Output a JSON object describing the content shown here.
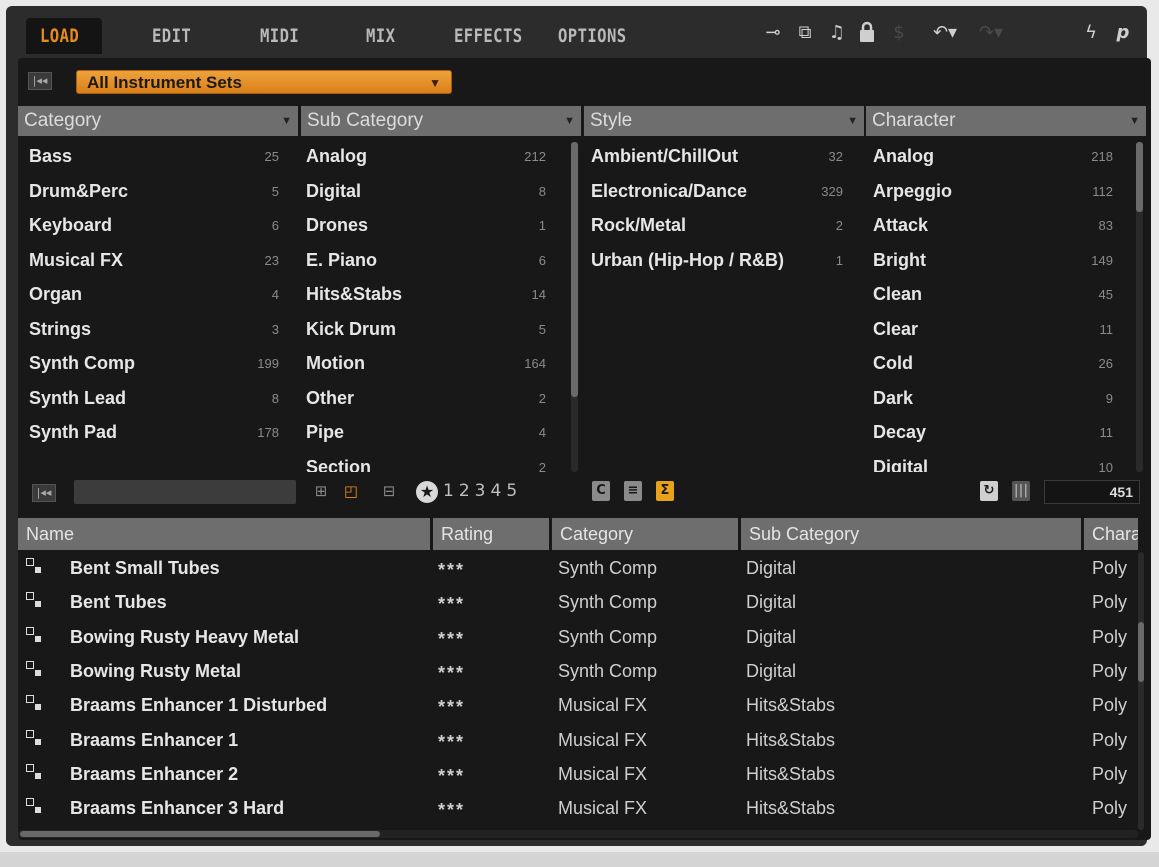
{
  "tabs": [
    {
      "label": "LOAD",
      "active": true
    },
    {
      "label": "EDIT"
    },
    {
      "label": "MIDI"
    },
    {
      "label": "MIX"
    },
    {
      "label": "EFFECTS"
    },
    {
      "label": "OPTIONS"
    }
  ],
  "toolbar_icons": [
    "plug-icon",
    "multi-plug-icon",
    "notes-icon",
    "lock-icon",
    "dollar-icon",
    "undo-icon",
    "redo-icon",
    "lightning-icon",
    "p-icon"
  ],
  "instrument_set": {
    "label": "All Instrument Sets"
  },
  "filters": [
    {
      "header": "Category",
      "items": [
        {
          "label": "Bass",
          "count": "25"
        },
        {
          "label": "Drum&Perc",
          "count": "5"
        },
        {
          "label": "Keyboard",
          "count": "6"
        },
        {
          "label": "Musical FX",
          "count": "23"
        },
        {
          "label": "Organ",
          "count": "4"
        },
        {
          "label": "Strings",
          "count": "3"
        },
        {
          "label": "Synth Comp",
          "count": "199"
        },
        {
          "label": "Synth Lead",
          "count": "8"
        },
        {
          "label": "Synth Pad",
          "count": "178"
        }
      ]
    },
    {
      "header": "Sub Category",
      "items": [
        {
          "label": "Analog",
          "count": "212"
        },
        {
          "label": "Digital",
          "count": "8"
        },
        {
          "label": "Drones",
          "count": "1"
        },
        {
          "label": "E. Piano",
          "count": "6"
        },
        {
          "label": "Hits&Stabs",
          "count": "14"
        },
        {
          "label": "Kick Drum",
          "count": "5"
        },
        {
          "label": "Motion",
          "count": "164"
        },
        {
          "label": "Other",
          "count": "2"
        },
        {
          "label": "Pipe",
          "count": "4"
        },
        {
          "label": "Section",
          "count": "2"
        }
      ]
    },
    {
      "header": "Style",
      "items": [
        {
          "label": "Ambient/ChillOut",
          "count": "32"
        },
        {
          "label": "Electronica/Dance",
          "count": "329"
        },
        {
          "label": "Rock/Metal",
          "count": "2"
        },
        {
          "label": "Urban (Hip-Hop / R&B)",
          "count": "1"
        }
      ]
    },
    {
      "header": "Character",
      "items": [
        {
          "label": "Analog",
          "count": "218"
        },
        {
          "label": "Arpeggio",
          "count": "112"
        },
        {
          "label": "Attack",
          "count": "83"
        },
        {
          "label": "Bright",
          "count": "149"
        },
        {
          "label": "Clean",
          "count": "45"
        },
        {
          "label": "Clear",
          "count": "11"
        },
        {
          "label": "Cold",
          "count": "26"
        },
        {
          "label": "Dark",
          "count": "9"
        },
        {
          "label": "Decay",
          "count": "11"
        },
        {
          "label": "Digital",
          "count": "10"
        }
      ]
    }
  ],
  "rating_filter": [
    "1",
    "2",
    "3",
    "4",
    "5"
  ],
  "sigma_label": "Σ",
  "result_count": "451",
  "results_columns": [
    "Name",
    "Rating",
    "Category",
    "Sub Category",
    "Chara"
  ],
  "results": [
    {
      "name": "Bent Small Tubes",
      "rating": "***",
      "category": "Synth Comp",
      "sub": "Digital",
      "character": "Poly"
    },
    {
      "name": "Bent Tubes",
      "rating": "***",
      "category": "Synth Comp",
      "sub": "Digital",
      "character": "Poly"
    },
    {
      "name": "Bowing Rusty Heavy Metal",
      "rating": "***",
      "category": "Synth Comp",
      "sub": "Digital",
      "character": "Poly"
    },
    {
      "name": "Bowing Rusty Metal",
      "rating": "***",
      "category": "Synth Comp",
      "sub": "Digital",
      "character": "Poly"
    },
    {
      "name": "Braams Enhancer 1 Disturbed",
      "rating": "***",
      "category": "Musical FX",
      "sub": "Hits&Stabs",
      "character": "Poly"
    },
    {
      "name": "Braams Enhancer 1",
      "rating": "***",
      "category": "Musical FX",
      "sub": "Hits&Stabs",
      "character": "Poly"
    },
    {
      "name": "Braams Enhancer 2",
      "rating": "***",
      "category": "Musical FX",
      "sub": "Hits&Stabs",
      "character": "Poly"
    },
    {
      "name": "Braams Enhancer 3 Hard",
      "rating": "***",
      "category": "Musical FX",
      "sub": "Hits&Stabs",
      "character": "Poly"
    }
  ]
}
